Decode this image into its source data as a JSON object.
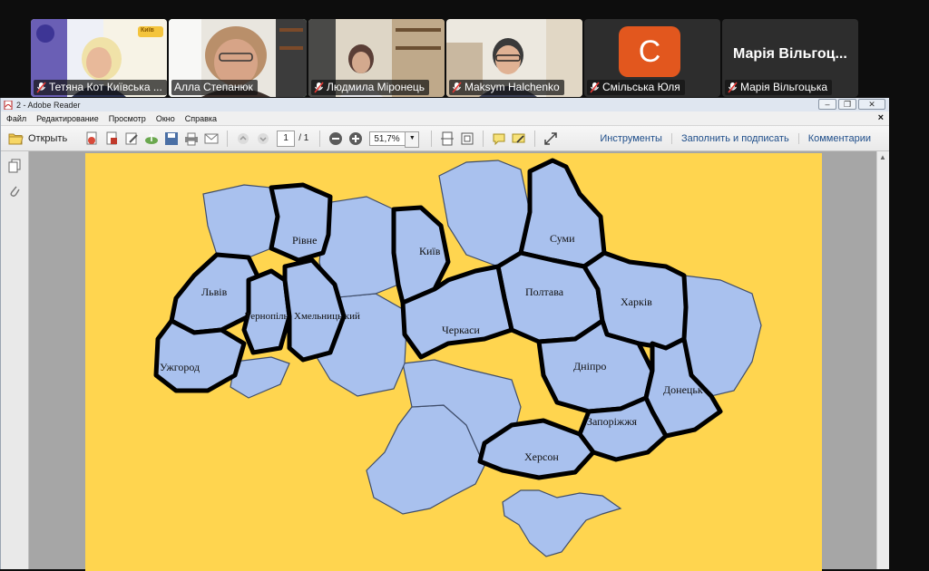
{
  "participants": [
    {
      "name": "Тетяна Кот Київська ...",
      "muted": true
    },
    {
      "name": "Алла Степанюк",
      "muted": false,
      "active": true
    },
    {
      "name": "Людмила Міронець",
      "muted": true
    },
    {
      "name": "Maksym Halchenko",
      "muted": true
    },
    {
      "name": "Смільська Юля",
      "muted": true,
      "avatar_letter": "C",
      "avatar_color": "#e2571e"
    },
    {
      "name": "Марія Вільгоцька",
      "muted": true,
      "display_name": "Марія Вільгоц..."
    }
  ],
  "tile1_banner": "Київ",
  "reader": {
    "window_title": "2 - Adobe Reader",
    "menu": [
      "Файл",
      "Редактирование",
      "Просмотр",
      "Окно",
      "Справка"
    ],
    "open_label": "Открыть",
    "page_current": "1",
    "page_total": "/ 1",
    "zoom": "51,7%",
    "right_links": [
      "Инструменты",
      "Заполнить и подписать",
      "Комментарии"
    ]
  },
  "map": {
    "background": "#ffd54f",
    "fill": "#a9c1ee",
    "regions": [
      "Рівне",
      "Київ",
      "Суми",
      "Львів",
      "Тернопіль",
      "Хмельниць кий",
      "Полтава",
      "Харків",
      "Черкаси",
      "Ужгород",
      "Дніпро",
      "Донецьк",
      "Запоріжжя",
      "Херсон"
    ]
  }
}
